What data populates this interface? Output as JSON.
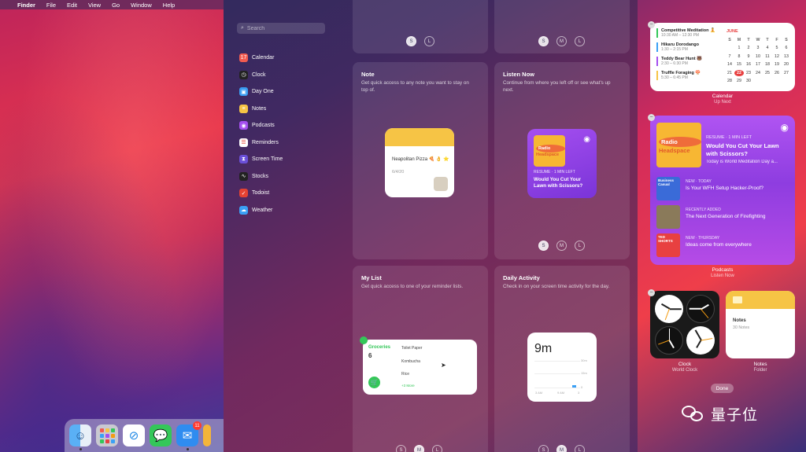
{
  "menubar": {
    "apple_glyph": "",
    "app_name": "Finder",
    "items": [
      "File",
      "Edit",
      "View",
      "Go",
      "Window",
      "Help"
    ]
  },
  "dock": {
    "apps": [
      {
        "name": "finder-icon",
        "glyph": "☺"
      },
      {
        "name": "launchpad-icon",
        "glyph": ""
      },
      {
        "name": "safari-icon",
        "glyph": "⊘"
      },
      {
        "name": "messages-icon",
        "glyph": "💬"
      },
      {
        "name": "mail-icon",
        "glyph": "✉"
      }
    ],
    "mail_badge": "11"
  },
  "gallery": {
    "search_placeholder": "Search",
    "apps": [
      {
        "label": "Calendar",
        "color": "#f25b50",
        "glyph": "17"
      },
      {
        "label": "Clock",
        "color": "#222222",
        "glyph": "◷"
      },
      {
        "label": "Day One",
        "color": "#3a9df2",
        "glyph": "▣"
      },
      {
        "label": "Notes",
        "color": "#f6c445",
        "glyph": "≡"
      },
      {
        "label": "Podcasts",
        "color": "#a54ff0",
        "glyph": "◉"
      },
      {
        "label": "Reminders",
        "color": "#ffffff",
        "glyph": "☰"
      },
      {
        "label": "Screen Time",
        "color": "#6a4fd8",
        "glyph": "⧗"
      },
      {
        "label": "Stocks",
        "color": "#222222",
        "glyph": "∿"
      },
      {
        "label": "Todoist",
        "color": "#e44232",
        "glyph": "✓"
      },
      {
        "label": "Weather",
        "color": "#3aa0f5",
        "glyph": "☁"
      }
    ],
    "panels": {
      "top_left_sizes": [
        "S",
        "L"
      ],
      "top_right_sizes": [
        "S",
        "M",
        "L"
      ],
      "note": {
        "title": "Note",
        "desc": "Get quick access to any note you want to stay on top of.",
        "widget_text": "Neapolitan Pizza 🍕 👌 ⭐",
        "widget_date": "6/4/20"
      },
      "listen_now": {
        "title": "Listen Now",
        "desc": "Continue from where you left off or see what's up next.",
        "art_line1": "Radio",
        "art_line2": "Headspace",
        "resume": "RESUME · 1 MIN LEFT",
        "episode": "Would You Cut Your Lawn with Scissors?",
        "sizes": [
          "S",
          "M",
          "L"
        ]
      },
      "my_list": {
        "title": "My List",
        "desc": "Get quick access to one of your reminder lists.",
        "list_name": "Groceries",
        "count": "6",
        "items": [
          "Toilet Paper",
          "Kombucha",
          "Rice"
        ],
        "more": "+3 More",
        "sizes": [
          "S",
          "M",
          "L"
        ]
      },
      "daily_activity": {
        "title": "Daily Activity",
        "desc": "Check in on your screen time activity for the day.",
        "total": "9m",
        "axis_labels": [
          "30m",
          "15m",
          "0"
        ],
        "x_labels": [
          "3 AM",
          "9 AM",
          "3"
        ],
        "sizes": [
          "S",
          "M",
          "L"
        ]
      }
    }
  },
  "calendar_widget": {
    "events": [
      {
        "title": "Competitive Meditation 🧘",
        "time": "10:30 AM – 12:30 PM",
        "color": "#34c759"
      },
      {
        "title": "Hikaru Dorodango",
        "time": "1:30 – 2:15 PM",
        "color": "#3aa0f5"
      },
      {
        "title": "Teddy Bear Hunt 🐻",
        "time": "2:30 – 6:30 PM",
        "color": "#a54ff0"
      },
      {
        "title": "Truffle Foraging 🍄",
        "time": "5:30 – 6:45 PM",
        "color": "#f6c445"
      }
    ],
    "month": "JUNE",
    "weekdays": [
      "S",
      "M",
      "T",
      "W",
      "T",
      "F",
      "S"
    ],
    "days": [
      "",
      "1",
      "2",
      "3",
      "4",
      "5",
      "6",
      "7",
      "8",
      "9",
      "10",
      "11",
      "12",
      "13",
      "14",
      "15",
      "16",
      "17",
      "18",
      "19",
      "20",
      "21",
      "22",
      "23",
      "24",
      "25",
      "26",
      "27",
      "28",
      "29",
      "30"
    ],
    "today": "22",
    "caption": "Calendar",
    "sub": "Up Next"
  },
  "podcasts_widget": {
    "art_line1": "Radio",
    "art_line2": "Headspace",
    "resume": "RESUME · 1 MIN LEFT",
    "episode": "Would You Cut Your Lawn with Scissors?",
    "subtitle": "Today is World Meditation Day a...",
    "rows": [
      {
        "tag": "NEW · TODAY",
        "name": "Is Your WFH Setup Hacker-Proof?",
        "art": "Business Casual",
        "color": "#3a6bd8"
      },
      {
        "tag": "RECENTLY ADDED",
        "name": "The Next Generation of Firefighting",
        "art": "",
        "color": "#8a7a5a"
      },
      {
        "tag": "NEW · THURSDAY",
        "name": "Ideas come from everywhere",
        "art": "TED SHORTS",
        "color": "#e84040"
      }
    ],
    "caption": "Podcasts",
    "sub": "Listen Now"
  },
  "clock_widget": {
    "caption": "Clock",
    "sub": "World Clock"
  },
  "notes_widget": {
    "title": "Notes",
    "count": "30 Notes",
    "caption": "Notes",
    "sub": "Folder"
  },
  "done_label": "Done",
  "watermark": "量子位"
}
